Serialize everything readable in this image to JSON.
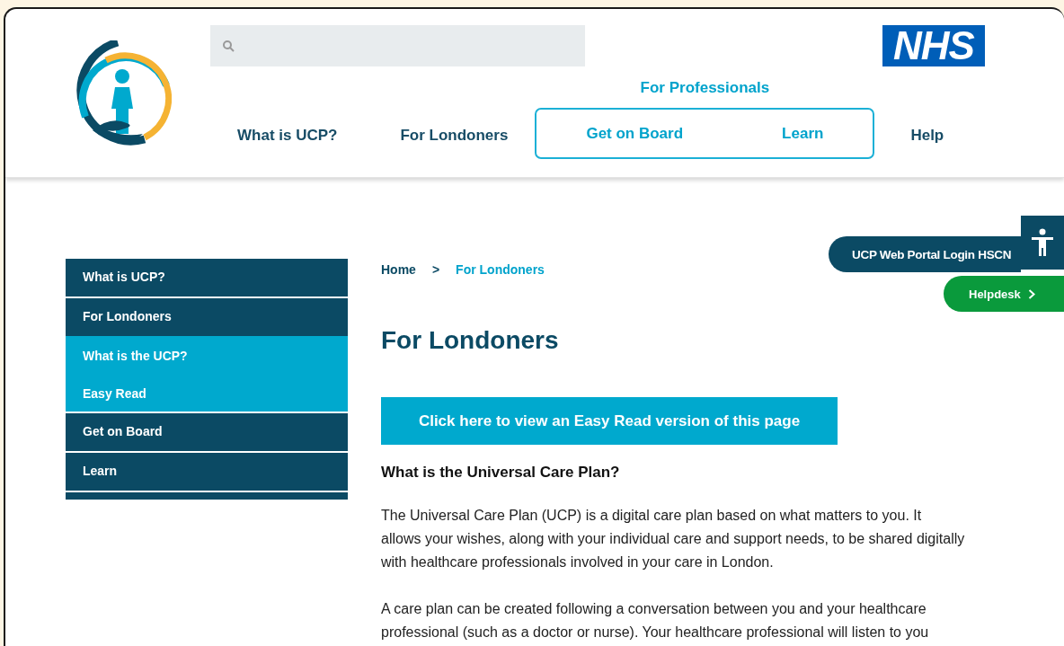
{
  "header": {
    "nhs_logo": {
      "text": "NHS"
    },
    "nav": [
      {
        "kind": "link",
        "label": "What is UCP?"
      },
      {
        "kind": "link",
        "label": "For Londoners"
      },
      {
        "kind": "group",
        "label": "For Professionals",
        "children": [
          {
            "label": "Get on Board"
          },
          {
            "label": "Learn"
          }
        ]
      },
      {
        "kind": "link",
        "label": "Help"
      }
    ]
  },
  "sidebar": {
    "items": [
      {
        "label": "What is UCP?",
        "expanded": false
      },
      {
        "label": "For Londoners",
        "expanded": true,
        "children": [
          {
            "label": "What is the UCP?"
          },
          {
            "label": "Easy Read"
          }
        ]
      },
      {
        "label": "Get on Board",
        "expanded": false
      },
      {
        "label": "Learn",
        "expanded": false
      }
    ]
  },
  "breadcrumb": {
    "separator": ">",
    "items": [
      {
        "label": "Home",
        "current": false
      },
      {
        "label": "For Londoners",
        "current": true
      }
    ]
  },
  "page": {
    "title": "For Londoners",
    "easy_read_button": "Click here to view an Easy Read version of this page",
    "section_heading": "What is the Universal Care Plan?",
    "paragraphs": [
      "The Universal Care Plan (UCP) is a digital care plan based on what matters to you. It allows your wishes, along with your individual care and support needs, to be shared digitally with healthcare professionals involved in your care in London.",
      "A care plan can be created following a conversation between you and your healthcare professional (such as a doctor or nurse). Your healthcare professional will listen to you"
    ]
  },
  "floating": {
    "portal_login": "UCP Web Portal Login HSCN",
    "helpdesk": "Helpdesk"
  }
}
